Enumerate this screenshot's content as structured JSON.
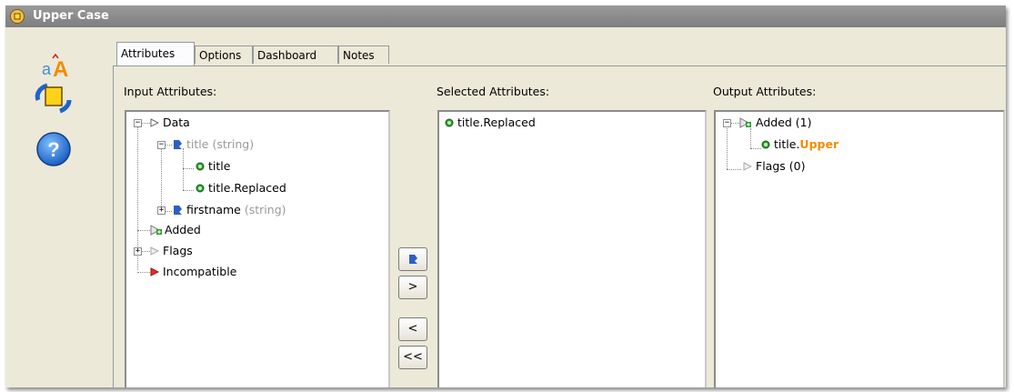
{
  "window": {
    "title": "Upper Case"
  },
  "tabs": [
    {
      "label": "Attributes",
      "active": true
    },
    {
      "label": "Options",
      "active": false
    },
    {
      "label": "Dashboard",
      "active": false
    },
    {
      "label": "Notes",
      "active": false
    }
  ],
  "panels": {
    "input_label": "Input Attributes:",
    "selected_label": "Selected Attributes:",
    "output_label": "Output Attributes:"
  },
  "input_tree": {
    "data": "Data",
    "title": "title",
    "title_type": "(string)",
    "title_child1": "title",
    "title_child2": "title.Replaced",
    "firstname": "firstname",
    "firstname_type": "(string)",
    "added": "Added",
    "flags": "Flags",
    "incompatible": "Incompatible"
  },
  "selected_list": [
    "title.Replaced"
  ],
  "output_tree": {
    "added": "Added (1)",
    "item_prefix": "title.",
    "item_suffix": "Upper",
    "flags": "Flags (0)"
  },
  "buttons": {
    "add_label": ">",
    "remove_label": "<",
    "remove_all_label": "<<"
  },
  "colors": {
    "highlight": "#f28c00",
    "attr_green": "#2e9e2e",
    "incompatible_red": "#e03030"
  }
}
